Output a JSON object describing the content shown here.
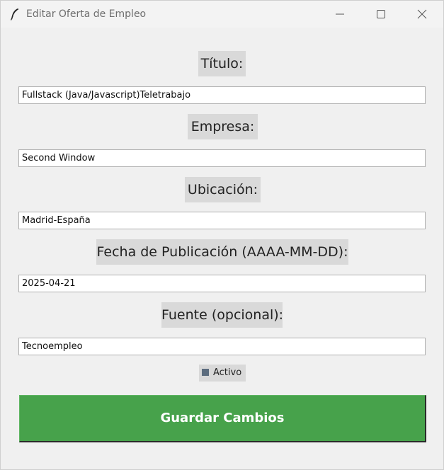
{
  "window": {
    "title": "Editar Oferta de Empleo",
    "icon": "feather-icon",
    "controls": [
      "minimize-icon",
      "maximize-icon",
      "close-icon"
    ]
  },
  "form": {
    "titulo": {
      "label": "Título:",
      "value": "Fullstack (Java/Javascript)Teletrabajo"
    },
    "empresa": {
      "label": "Empresa:",
      "value": "Second Window"
    },
    "ubicacion": {
      "label": "Ubicación:",
      "value": "Madrid-España"
    },
    "fecha": {
      "label": "Fecha de Publicación (AAAA-MM-DD):",
      "value": "2025-04-21"
    },
    "fuente": {
      "label": "Fuente (opcional):",
      "value": "Tecnoempleo"
    },
    "activo": {
      "label": "Activo",
      "checked": true
    }
  },
  "save_button": {
    "label": "Guardar Cambios"
  },
  "colors": {
    "button_green": "#47a24b",
    "label_bg": "#d9d9d9",
    "window_bg": "#f0f0f0",
    "checkbox_fill": "#5c6c7e"
  }
}
